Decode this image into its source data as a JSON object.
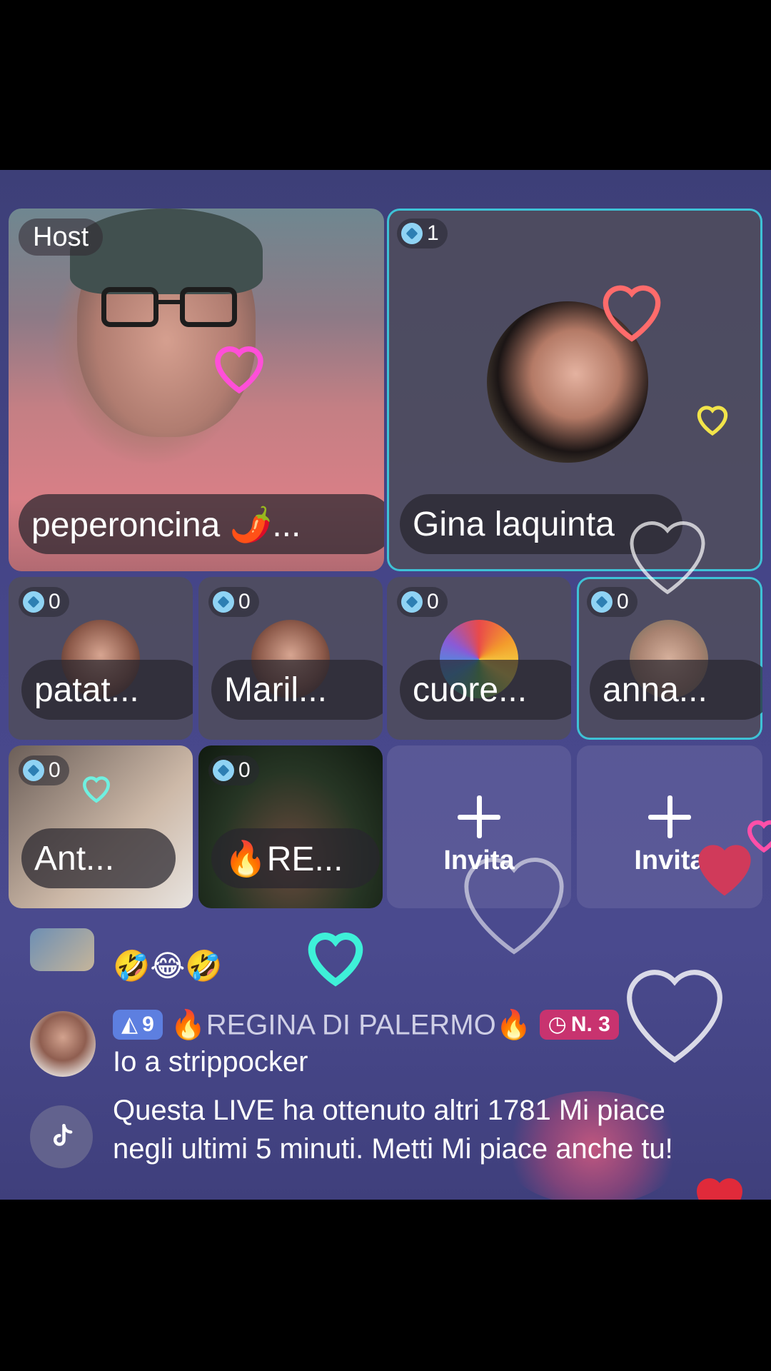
{
  "host": {
    "label": "Host",
    "name": "peperoncina 🌶️..."
  },
  "guest_main": {
    "count": "1",
    "name": "Gina laquinta"
  },
  "guests": [
    {
      "count": "0",
      "name": "patat..."
    },
    {
      "count": "0",
      "name": "Maril..."
    },
    {
      "count": "0",
      "name": "cuore..."
    },
    {
      "count": "0",
      "name": "anna..."
    },
    {
      "count": "0",
      "name": "Ant..."
    },
    {
      "count": "0",
      "name": "🔥RE..."
    }
  ],
  "invite": {
    "label_1": "Invita",
    "label_2": "Invita"
  },
  "chat": {
    "emoji_message": "🤣😂🤣",
    "user_level": "9",
    "username": "🔥REGINA  DI PALERMO🔥",
    "rank_label": "N. 3",
    "message": "Io a strippocker",
    "system_message": "Questa LIVE ha ottenuto altri 1781 Mi piace negli ultimi 5 minuti. Metti Mi piace anche tu!"
  },
  "colors": {
    "background": "#45458a",
    "active_border": "#3ec2d6",
    "level_badge": "#5d7fe0",
    "rank_badge": "#c8336f"
  }
}
